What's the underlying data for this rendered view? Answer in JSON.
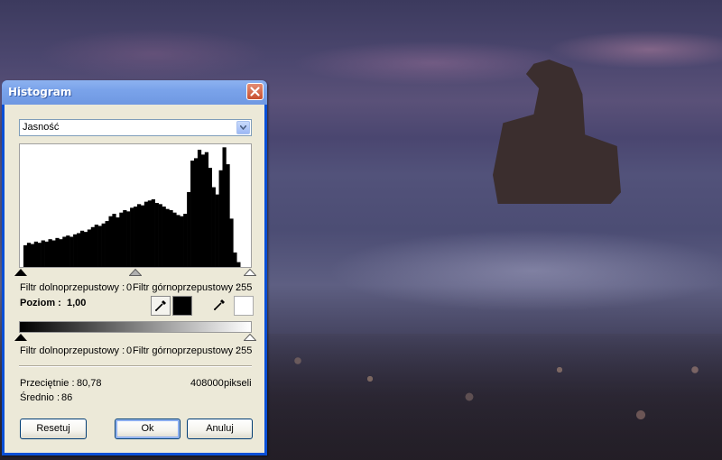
{
  "window": {
    "title": "Histogram"
  },
  "channel_select": {
    "value": "Jasność"
  },
  "histogram": {
    "bins": [
      0.0,
      0.18,
      0.2,
      0.19,
      0.21,
      0.2,
      0.22,
      0.21,
      0.23,
      0.22,
      0.24,
      0.23,
      0.25,
      0.26,
      0.25,
      0.27,
      0.28,
      0.3,
      0.29,
      0.31,
      0.33,
      0.35,
      0.34,
      0.36,
      0.38,
      0.42,
      0.44,
      0.41,
      0.45,
      0.47,
      0.46,
      0.49,
      0.5,
      0.52,
      0.51,
      0.54,
      0.55,
      0.56,
      0.53,
      0.52,
      0.5,
      0.48,
      0.47,
      0.45,
      0.43,
      0.42,
      0.44,
      0.62,
      0.88,
      0.9,
      0.97,
      0.93,
      0.95,
      0.82,
      0.66,
      0.6,
      0.8,
      0.99,
      0.85,
      0.4,
      0.12,
      0.04,
      0.0,
      0.0,
      0.0
    ]
  },
  "input_filter": {
    "low_label": "Filtr dolnoprzepustowy :",
    "low_value": "0",
    "high_label": "Filtr górnoprzepustowy :",
    "high_value": "255"
  },
  "gamma": {
    "label": "Poziom :",
    "value": "1,00"
  },
  "output_filter": {
    "low_label": "Filtr dolnoprzepustowy :",
    "low_value": "0",
    "high_label": "Filtr górnoprzepustowy :",
    "high_value": "255"
  },
  "stats": {
    "mean_label": "Przeciętnie :",
    "mean_value": "80,78",
    "median_label": "Średnio :",
    "median_value": "86",
    "pixels_value": "408000",
    "pixels_unit": "pikseli"
  },
  "buttons": {
    "reset": "Resetuj",
    "ok": "Ok",
    "cancel": "Anuluj"
  },
  "colors": {
    "titlebar": "#7aa3ea",
    "dialog_bg": "#ece9d8",
    "close": "#c8502f"
  },
  "icons": {
    "close": "close-icon",
    "dropdown": "chevron-down-icon",
    "picker": "eyedropper-icon"
  }
}
